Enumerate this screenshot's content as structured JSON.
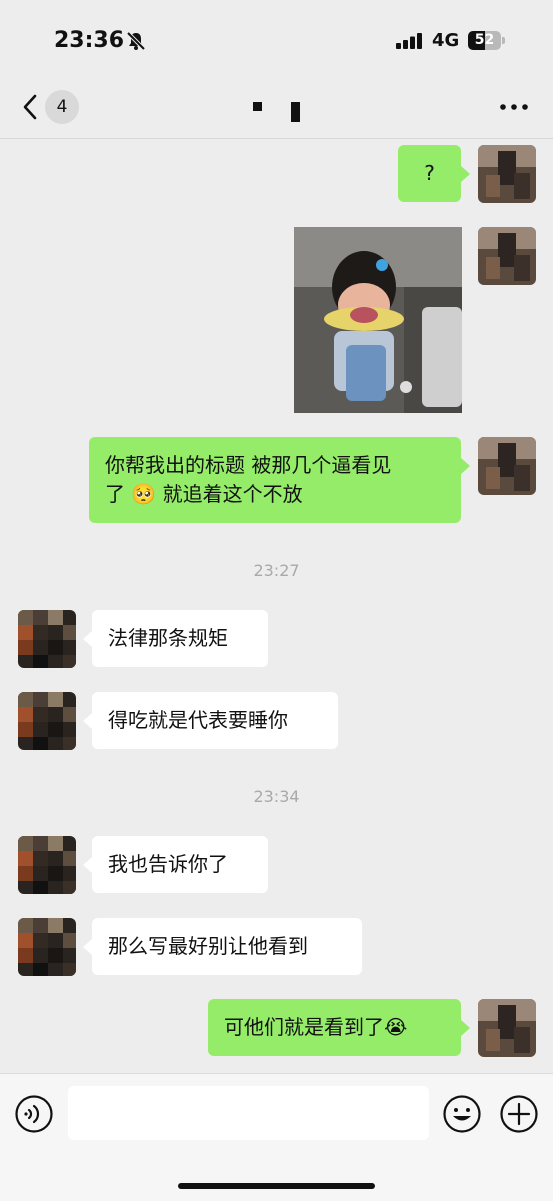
{
  "status_bar": {
    "time": "23:36",
    "network": "4G",
    "battery": "52",
    "battery_level_percent": 52
  },
  "nav": {
    "unread_count": "4",
    "back_icon": "chevron-left-icon",
    "more_icon": "more-icon"
  },
  "messages": [
    {
      "side": "me",
      "text": "?"
    },
    {
      "side": "me",
      "type": "image"
    },
    {
      "side": "me",
      "line1": "你帮我出的标题 被那几个逼看见",
      "line2": "了 🥺 就追着这个不放"
    },
    {
      "timestamp": "23:27"
    },
    {
      "side": "other",
      "text": "法律那条规矩"
    },
    {
      "side": "other",
      "text": "得吃就是代表要睡你"
    },
    {
      "timestamp": "23:34"
    },
    {
      "side": "other",
      "text": "我也告诉你了"
    },
    {
      "side": "other",
      "text": "那么写最好别让他看到"
    },
    {
      "side": "me",
      "text": "可他们就是看到了😭"
    }
  ],
  "input_bar": {
    "voice_icon": "voice-icon",
    "emoji_icon": "emoji-icon",
    "add_icon": "plus-circle-icon",
    "input_value": ""
  },
  "colors": {
    "self_bubble": "#95ec69",
    "other_bubble": "#ffffff",
    "background": "#ededed"
  }
}
